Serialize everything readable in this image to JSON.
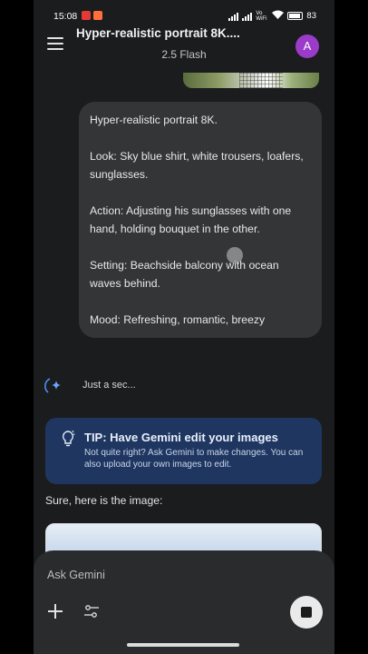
{
  "status_bar": {
    "time": "15:08",
    "net_label": "Vo WiFi",
    "battery": "83"
  },
  "header": {
    "title": "Hyper-realistic portrait 8K....",
    "model": "2.5 Flash",
    "avatar_initial": "A",
    "avatar_color": "#9b3bc9"
  },
  "user_message": {
    "lines": [
      "Hyper-realistic portrait 8K.",
      "Look: Sky blue shirt, white trousers, loafers, sunglasses.",
      "Action: Adjusting his sunglasses with one hand, holding bouquet in the other.",
      "Setting: Beachside balcony with ocean waves behind.",
      "Mood: Refreshing, romantic, breezy"
    ]
  },
  "thinking": {
    "icon": "gemini-spark-icon",
    "label": "Just a sec..."
  },
  "tip": {
    "icon": "lightbulb-icon",
    "title": "TIP: Have Gemini edit your images",
    "body": "Not quite right? Ask Gemini to make changes. You can also upload your own images to edit.",
    "background": "#1f3760"
  },
  "response": {
    "text": "Sure, here is the image:"
  },
  "input": {
    "placeholder": "Ask Gemini",
    "add_icon": "plus-icon",
    "tools_icon": "sliders-icon",
    "stop_icon": "stop-icon"
  },
  "colors": {
    "background": "#1b1c1e",
    "bubble": "#333537",
    "accent": "#4285f4"
  }
}
